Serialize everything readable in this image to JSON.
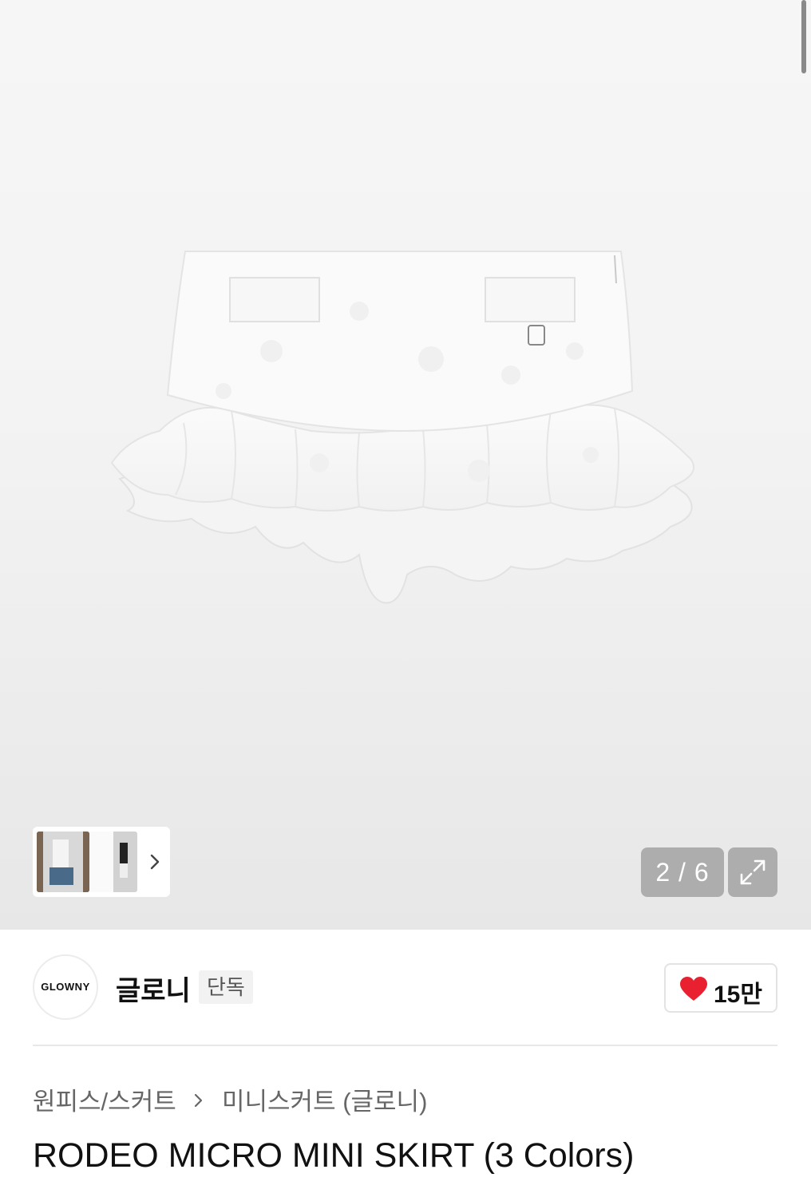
{
  "gallery": {
    "counter": "2 / 6",
    "current_index": 2,
    "total": 6,
    "thumbnails": [
      "thumbnail-1",
      "thumbnail-2"
    ],
    "icons": {
      "thumbnail_next": "chevron-right-icon",
      "expand": "expand-icon"
    }
  },
  "brand": {
    "logo_text": "GLOWNY",
    "name": "글로니",
    "badge": "단독",
    "likes": "15만",
    "like_icon": "heart-icon",
    "like_color": "#e8202f"
  },
  "breadcrumb": {
    "items": [
      "원피스/스커트",
      "미니스커트 (글로니)"
    ],
    "separator_icon": "chevron-right-icon"
  },
  "product": {
    "title": "RODEO MICRO MINI SKIRT (3 Colors)"
  }
}
